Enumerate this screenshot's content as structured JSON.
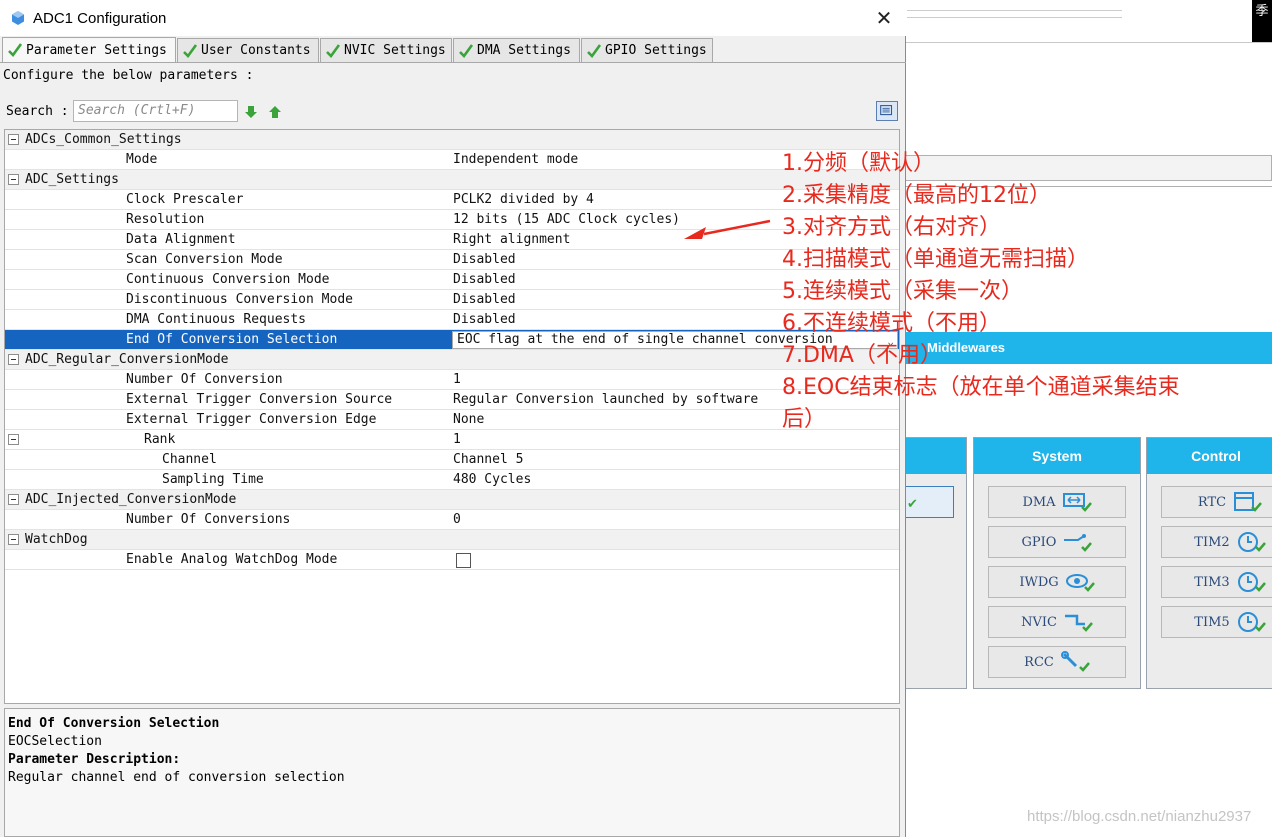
{
  "dialog": {
    "title": "ADC1 Configuration",
    "close_glyph": "✕",
    "tabs": [
      {
        "label": "Parameter Settings",
        "active": true
      },
      {
        "label": "User Constants",
        "active": false
      },
      {
        "label": "NVIC Settings",
        "active": false
      },
      {
        "label": "DMA Settings",
        "active": false
      },
      {
        "label": "GPIO Settings",
        "active": false
      }
    ],
    "configure_label": "Configure the below parameters :",
    "search": {
      "label": "Search :",
      "placeholder": "Search (Crtl+F)"
    }
  },
  "groups": {
    "adcs_common": {
      "name": "ADCs_Common_Settings"
    },
    "adc_settings": {
      "name": "ADC_Settings"
    },
    "adc_regular": {
      "name": "ADC_Regular_ConversionMode"
    },
    "adc_injected": {
      "name": "ADC_Injected_ConversionMode"
    },
    "watchdog": {
      "name": "WatchDog"
    }
  },
  "params": {
    "mode": {
      "name": "Mode",
      "value": "Independent mode"
    },
    "clock_prescaler": {
      "name": "Clock Prescaler",
      "value": "PCLK2 divided by 4"
    },
    "resolution": {
      "name": "Resolution",
      "value": "12 bits (15 ADC Clock cycles)"
    },
    "data_alignment": {
      "name": "Data Alignment",
      "value": "Right alignment"
    },
    "scan_mode": {
      "name": "Scan Conversion Mode",
      "value": "Disabled"
    },
    "continuous_mode": {
      "name": "Continuous Conversion Mode",
      "value": "Disabled"
    },
    "discontinuous_mode": {
      "name": "Discontinuous Conversion Mode",
      "value": "Disabled"
    },
    "dma_requests": {
      "name": "DMA Continuous Requests",
      "value": "Disabled"
    },
    "eoc_selection": {
      "name": "End Of Conversion Selection",
      "value": "EOC flag at the end of single channel conversion"
    },
    "number_of_conversion": {
      "name": "Number Of Conversion",
      "value": "1"
    },
    "ext_trigger_source": {
      "name": "External Trigger Conversion Source",
      "value": "Regular Conversion launched by software"
    },
    "ext_trigger_edge": {
      "name": "External Trigger Conversion Edge",
      "value": "None"
    },
    "rank": {
      "name": "Rank",
      "value": "1"
    },
    "channel": {
      "name": "Channel",
      "value": "Channel 5"
    },
    "sampling_time": {
      "name": "Sampling Time",
      "value": "480 Cycles"
    },
    "number_of_conversions_injected": {
      "name": "Number Of Conversions",
      "value": "0"
    },
    "analog_watchdog": {
      "name": "Enable Analog WatchDog Mode",
      "checked": false
    }
  },
  "description": {
    "title": "End Of Conversion Selection",
    "identifier": "EOCSelection",
    "param_desc_label": "Parameter Description:",
    "param_desc_text": "Regular channel end of conversion selection"
  },
  "annotations": [
    "1.分频（默认）",
    "2.采集精度（最高的12位）",
    "3.对齐方式（右对齐）",
    "4.扫描模式（单通道无需扫描）",
    "5.连续模式（采集一次）",
    "6.不连续模式（不用）",
    "7.DMA（不用）",
    "8.EOC结束标志（放在单个通道采集结束",
    "后）"
  ],
  "background": {
    "corner_text": "季",
    "middlewares_label": "Middlewares",
    "system_label": "System",
    "control_label": "Control",
    "system_buttons": [
      "DMA",
      "GPIO",
      "IWDG",
      "NVIC",
      "RCC"
    ],
    "control_buttons": [
      "RTC",
      "TIM2",
      "TIM3",
      "TIM5"
    ]
  },
  "watermark": "https://blog.csdn.net/nianzhu2937",
  "colors": {
    "accent": "#1fb4ea",
    "selection": "#1565c0",
    "annotation": "#e8291e",
    "check": "#3aa43a"
  }
}
